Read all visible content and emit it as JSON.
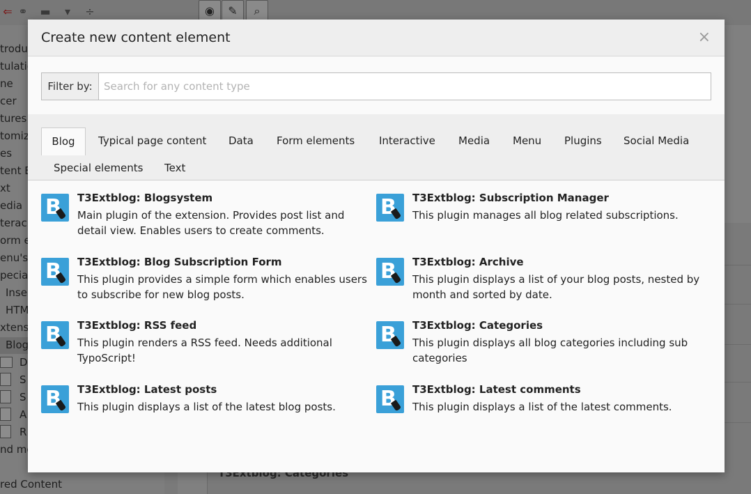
{
  "background": {
    "tree_rows": [
      "troduc",
      "tulatio",
      "ne",
      "cer",
      "tures",
      "tomiz",
      "es",
      "tent E",
      "xt",
      "edia",
      "terac",
      "orm e",
      "enu's",
      "pecial",
      "Inse",
      "HTM",
      "xtensi",
      "Blog",
      "D",
      "S",
      "S",
      "A",
      "R",
      "nd mo",
      "red Content"
    ],
    "content_label": "T3Extblog: Categories"
  },
  "modal": {
    "title": "Create new content element",
    "close": "×",
    "filter": {
      "label": "Filter by:",
      "placeholder": "Search for any content type",
      "value": ""
    },
    "tabs": [
      {
        "label": "Blog",
        "active": true
      },
      {
        "label": "Typical page content",
        "active": false
      },
      {
        "label": "Data",
        "active": false
      },
      {
        "label": "Form elements",
        "active": false
      },
      {
        "label": "Interactive",
        "active": false
      },
      {
        "label": "Media",
        "active": false
      },
      {
        "label": "Menu",
        "active": false
      },
      {
        "label": "Plugins",
        "active": false
      },
      {
        "label": "Social Media",
        "active": false
      },
      {
        "label": "Special elements",
        "active": false
      },
      {
        "label": "Text",
        "active": false
      }
    ],
    "items": [
      {
        "title": "T3Extblog: Blogsystem",
        "description": "Main plugin of the extension. Provides post list and detail view. Enables users to create comments.",
        "icon": "blog-plugin-icon"
      },
      {
        "title": "T3Extblog: Subscription Manager",
        "description": "This plugin manages all blog related subscriptions.",
        "icon": "blog-plugin-icon"
      },
      {
        "title": "T3Extblog: Blog Subscription Form",
        "description": "This plugin provides a simple form which enables users to subscribe for new blog posts.",
        "icon": "blog-plugin-icon"
      },
      {
        "title": "T3Extblog: Archive",
        "description": "This plugin displays a list of your blog posts, nested by month and sorted by date.",
        "icon": "blog-plugin-icon"
      },
      {
        "title": "T3Extblog: RSS feed",
        "description": "This plugin renders a RSS feed. Needs additional TypoScript!",
        "icon": "blog-plugin-icon"
      },
      {
        "title": "T3Extblog: Categories",
        "description": "This plugin displays all blog categories including sub categories",
        "icon": "blog-plugin-icon"
      },
      {
        "title": "T3Extblog: Latest posts",
        "description": "This plugin displays a list of the latest blog posts.",
        "icon": "blog-plugin-icon"
      },
      {
        "title": "T3Extblog: Latest comments",
        "description": "This plugin displays a list of the latest comments.",
        "icon": "blog-plugin-icon"
      }
    ]
  },
  "colors": {
    "icon_blue": "#3aa0d8",
    "header_bg": "#eeeeee",
    "body_bg": "#fafafa"
  }
}
